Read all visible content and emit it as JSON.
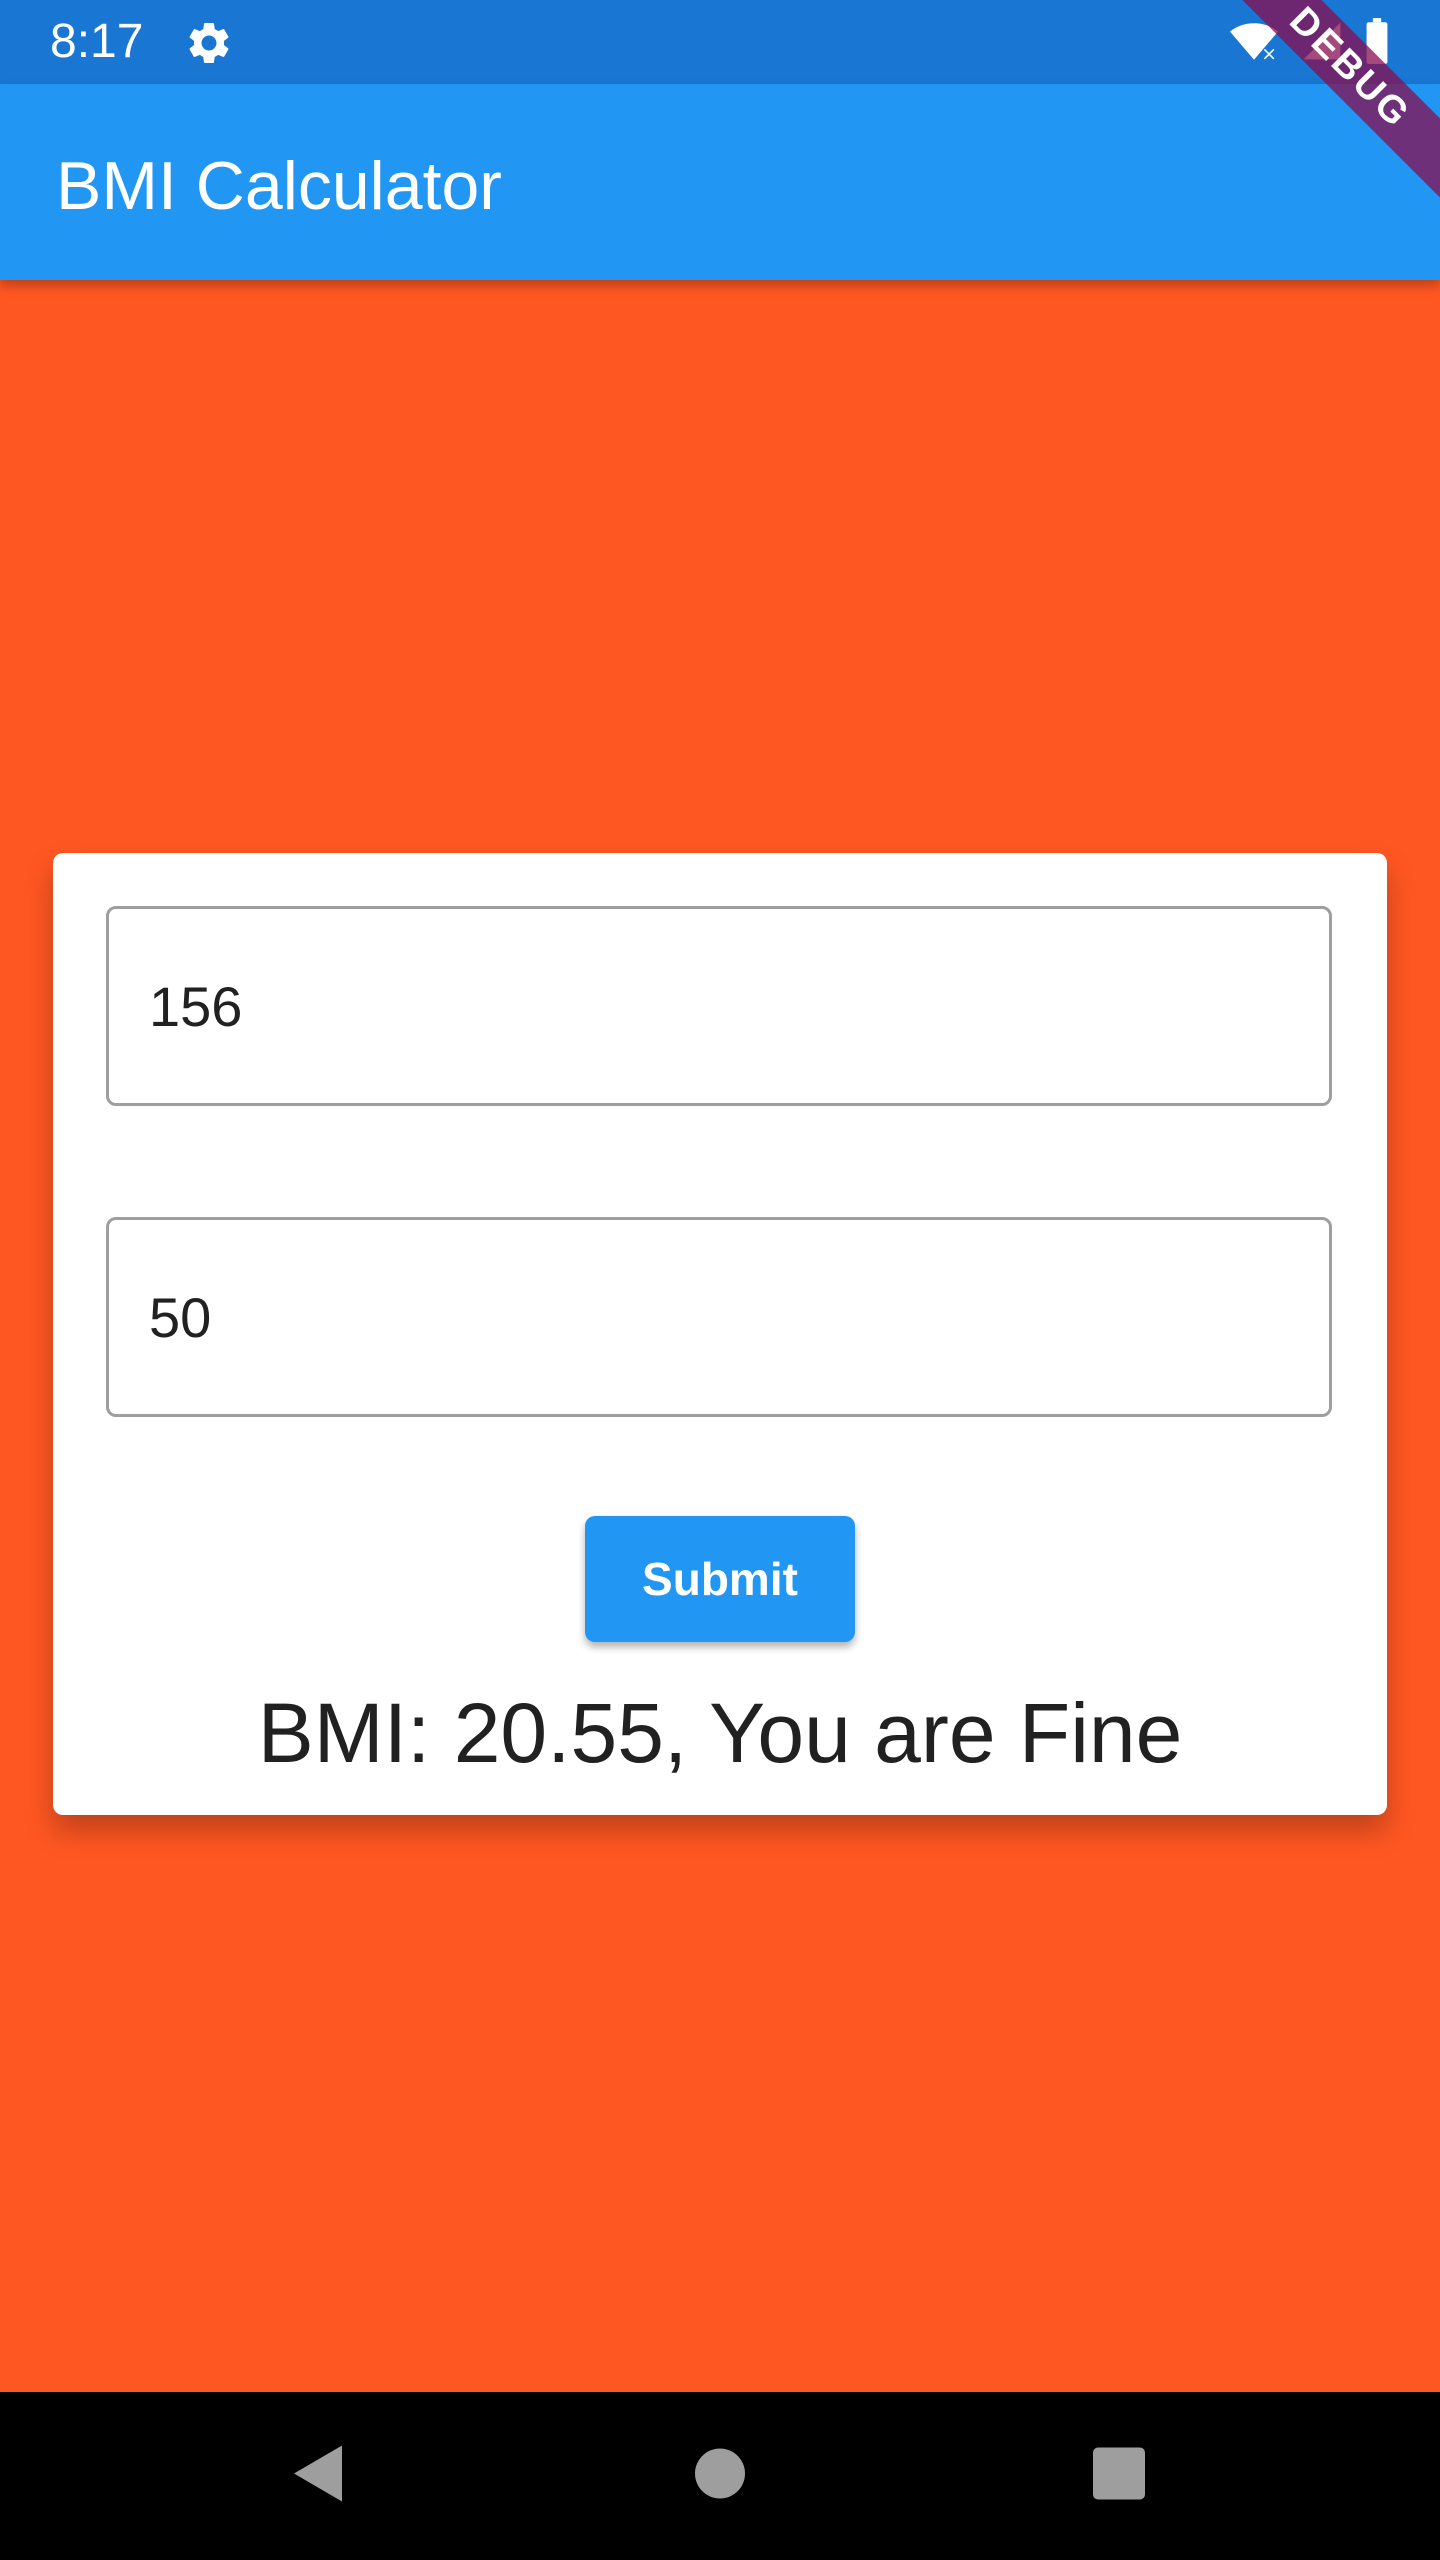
{
  "status_bar": {
    "time": "8:17",
    "icons": [
      "gear-icon",
      "wifi-icon",
      "signal-icon",
      "battery-icon"
    ]
  },
  "app_bar": {
    "title": "BMI Calculator"
  },
  "debug_banner": {
    "label": "DEBUG"
  },
  "form": {
    "height_value": "156",
    "weight_value": "50",
    "submit_label": "Submit",
    "result_text": "BMI: 20.55, You are Fine"
  },
  "nav_bar": {
    "icons": [
      "back-icon",
      "home-icon",
      "recents-icon"
    ]
  },
  "colors": {
    "status_bar": "#1976D2",
    "app_bar": "#2196F3",
    "background": "#FF5722",
    "button": "#2196F3",
    "card": "#FFFFFF"
  }
}
